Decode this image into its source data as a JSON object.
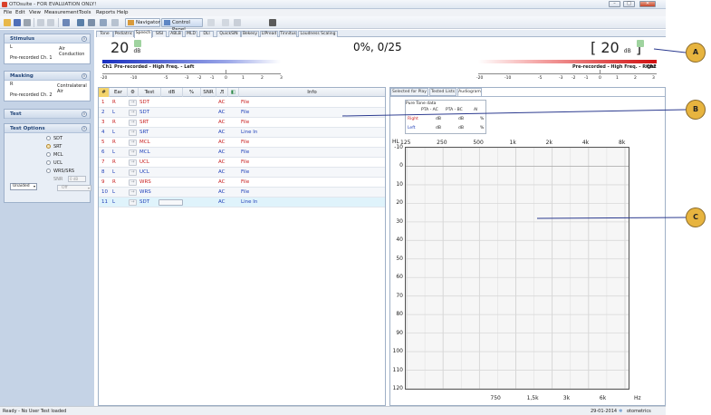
{
  "window": {
    "title": "OTOsuite - FOR EVALUATION ONLY!",
    "minimize_label": "–",
    "maximize_label": "□",
    "close_label": "✕"
  },
  "menu": [
    "File",
    "Edit",
    "View",
    "Measurement",
    "Tools",
    "Reports",
    "Help"
  ],
  "toolbar": {
    "navigator_label": "Navigator",
    "control_panel_label": "Control Panel"
  },
  "left_panel": {
    "stimulus": {
      "title": "Stimulus",
      "ear": "L",
      "mode": "Air Conduction",
      "source": "Pre-recorded Ch. 1"
    },
    "masking": {
      "title": "Masking",
      "ear": "R",
      "mode": "Contralateral Air",
      "source": "Pre-recorded Ch. 2"
    },
    "test": {
      "title": "Test"
    },
    "test_options": {
      "title": "Test Options",
      "options": [
        "SDT",
        "SRT",
        "MCL",
        "UCL",
        "WRS/SRS"
      ],
      "selected": "SRT",
      "snr_label": "SNR",
      "snr_value": "0 dB",
      "aided_value": "Unaided",
      "off_value": "Off"
    }
  },
  "tabs": [
    "Tone",
    "Pediatric",
    "Speech",
    "SISI",
    "ABLB",
    "MLD",
    "DLI",
    "QuickSIN",
    "Bekesy",
    "LIPread",
    "Tinnitus",
    "Loudness Scaling"
  ],
  "active_tab": "Speech",
  "levels": {
    "left_value": "20",
    "left_unit": "dB",
    "status": "0%, 0/25",
    "right_value": "20",
    "right_unit": "dB",
    "right_bracket_open": "[",
    "right_bracket_close": "]",
    "ch1_label": "Ch1",
    "ch1_text": "Pre-recorded - High Freq. - Left",
    "ch2_text": "Pre-recorded - High Freq. - Right",
    "ch2_label": "Ch2",
    "left_scale": [
      "-20",
      "-10",
      "-5",
      "-3",
      "-2",
      "-1",
      "0",
      "1",
      "2",
      "3"
    ],
    "right_scale": [
      "-20",
      "-10",
      "-5",
      "-3",
      "-2",
      "-1",
      "0",
      "1",
      "2",
      "3"
    ]
  },
  "table": {
    "headers": [
      "#",
      "Ear",
      "",
      "Test",
      "dB",
      "%",
      "SNR",
      "",
      "",
      "Info"
    ],
    "rows": [
      {
        "n": "1",
        "ear": "R",
        "test": "SDT",
        "ac": "AC",
        "info": "File",
        "side": "red"
      },
      {
        "n": "2",
        "ear": "L",
        "test": "SDT",
        "ac": "AC",
        "info": "File",
        "side": "blue"
      },
      {
        "n": "3",
        "ear": "R",
        "test": "SRT",
        "ac": "AC",
        "info": "File",
        "side": "red"
      },
      {
        "n": "4",
        "ear": "L",
        "test": "SRT",
        "ac": "AC",
        "info": "Line In",
        "side": "blue"
      },
      {
        "n": "5",
        "ear": "R",
        "test": "MCL",
        "ac": "AC",
        "info": "File",
        "side": "red"
      },
      {
        "n": "6",
        "ear": "L",
        "test": "MCL",
        "ac": "AC",
        "info": "File",
        "side": "blue"
      },
      {
        "n": "7",
        "ear": "R",
        "test": "UCL",
        "ac": "AC",
        "info": "File",
        "side": "red"
      },
      {
        "n": "8",
        "ear": "L",
        "test": "UCL",
        "ac": "AC",
        "info": "File",
        "side": "blue"
      },
      {
        "n": "9",
        "ear": "R",
        "test": "WRS",
        "ac": "AC",
        "info": "File",
        "side": "red"
      },
      {
        "n": "10",
        "ear": "L",
        "test": "WRS",
        "ac": "AC",
        "info": "File",
        "side": "blue"
      },
      {
        "n": "11",
        "ear": "L",
        "test": "SDT",
        "ac": "AC",
        "info": "Line In",
        "side": "blue"
      }
    ]
  },
  "right_panel": {
    "tabs": [
      "Selected for Play",
      "Tested Lists",
      "Audiogram"
    ],
    "active_tab": "Audiogram",
    "pta": {
      "title": "Pure Tone data",
      "col_headers": [
        "PTA - AC",
        "PTA - BC",
        "AI"
      ],
      "rows": [
        {
          "label": "Right",
          "cells": [
            "dB",
            "dB",
            "%"
          ]
        },
        {
          "label": "Left",
          "cells": [
            "dB",
            "dB",
            "%"
          ]
        }
      ]
    },
    "audiogram": {
      "hl_label": "HL",
      "hz_label": "Hz",
      "top_freqs": [
        "125",
        "250",
        "500",
        "1k",
        "2k",
        "4k",
        "8k"
      ],
      "bottom_freqs": [
        "750",
        "1,5k",
        "3k",
        "6k"
      ],
      "y_ticks": [
        "-10",
        "0",
        "10",
        "20",
        "30",
        "40",
        "50",
        "60",
        "70",
        "80",
        "90",
        "100",
        "110",
        "120"
      ]
    }
  },
  "statusbar": {
    "left": "Ready - No User Test loaded",
    "date": "29-01-2014",
    "brand": "otometrics"
  },
  "callouts": [
    "A",
    "B",
    "C"
  ],
  "colors": {
    "right_ear": "#c81f1f",
    "left_ear": "#1f3fb8",
    "callout": "#e7b43f",
    "highlight_row": "#dff3fb"
  }
}
